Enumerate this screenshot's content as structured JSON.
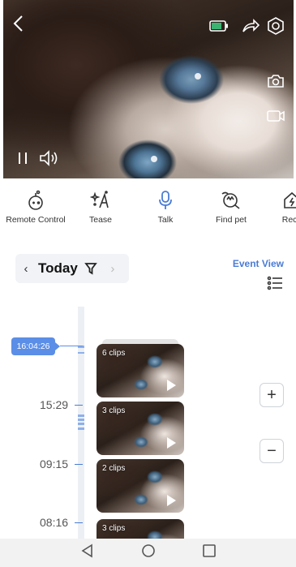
{
  "video": {
    "controls": {
      "back_icon": "chevron-left-icon",
      "battery_icon": "battery-icon",
      "share_icon": "share-arrow-icon",
      "settings_icon": "hexagon-settings-icon",
      "snapshot_icon": "camera-icon",
      "record_icon": "video-record-icon",
      "pause_icon": "pause-icon",
      "volume_icon": "speaker-icon"
    },
    "battery_color": "#3cb371"
  },
  "actions": [
    {
      "label": "Remote Control",
      "icon": "toy-controller-icon"
    },
    {
      "label": "Tease",
      "icon": "sparkle-wand-icon"
    },
    {
      "label": "Talk",
      "icon": "microphone-icon"
    },
    {
      "label": "Find pet",
      "icon": "pet-search-icon"
    },
    {
      "label": "Rech",
      "icon": "recharge-icon"
    }
  ],
  "date_bar": {
    "prev": "‹",
    "label": "Today",
    "next": "›"
  },
  "event_view": {
    "label": "Event View"
  },
  "timeline": {
    "current_time": "16:04:26",
    "labels": [
      "15:29",
      "09:15",
      "08:16"
    ]
  },
  "clips": [
    {
      "count": "6 clips"
    },
    {
      "count": "3 clips"
    },
    {
      "count": "2 clips"
    },
    {
      "count": "3 clips"
    }
  ],
  "zoom": {
    "in_label": "+",
    "out_label": "−"
  },
  "colors": {
    "accent": "#4a7cd6",
    "timeline_marker": "#5b8ee6"
  }
}
